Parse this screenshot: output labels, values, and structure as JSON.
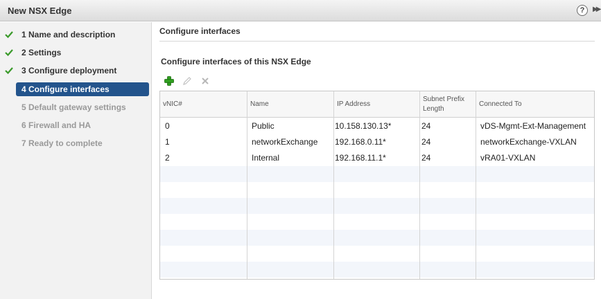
{
  "window": {
    "title": "New NSX Edge",
    "help_label": "?",
    "expand_label": "▶▶"
  },
  "steps": [
    {
      "label": "1  Name and description",
      "status": "done"
    },
    {
      "label": "2  Settings",
      "status": "done"
    },
    {
      "label": "3  Configure deployment",
      "status": "done"
    },
    {
      "label": "4  Configure interfaces",
      "status": "active"
    },
    {
      "label": "5  Default gateway settings",
      "status": "pending"
    },
    {
      "label": "6  Firewall and HA",
      "status": "pending"
    },
    {
      "label": "7  Ready to complete",
      "status": "pending"
    }
  ],
  "main": {
    "section_title": "Configure interfaces",
    "sub_title": "Configure interfaces of this NSX Edge",
    "toolbar": {
      "add_icon": "add-icon",
      "edit_icon": "edit-pencil-icon",
      "delete_icon": "delete-x-icon"
    },
    "table": {
      "columns": [
        "vNIC#",
        "Name",
        "IP Address",
        "Subnet Prefix Length",
        "Connected To"
      ],
      "rows": [
        [
          "0",
          "Public",
          "10.158.130.13*",
          "24",
          "vDS-Mgmt-Ext-Management"
        ],
        [
          "1",
          "networkExchange",
          "192.168.0.11*",
          "24",
          "networkExchange-VXLAN"
        ],
        [
          "2",
          "Internal",
          "192.168.11.1*",
          "24",
          "vRA01-VXLAN"
        ]
      ]
    }
  },
  "colors": {
    "active_step_bg": "#23548c",
    "check_green": "#3a9a2a",
    "add_green": "#2f9e1f"
  }
}
